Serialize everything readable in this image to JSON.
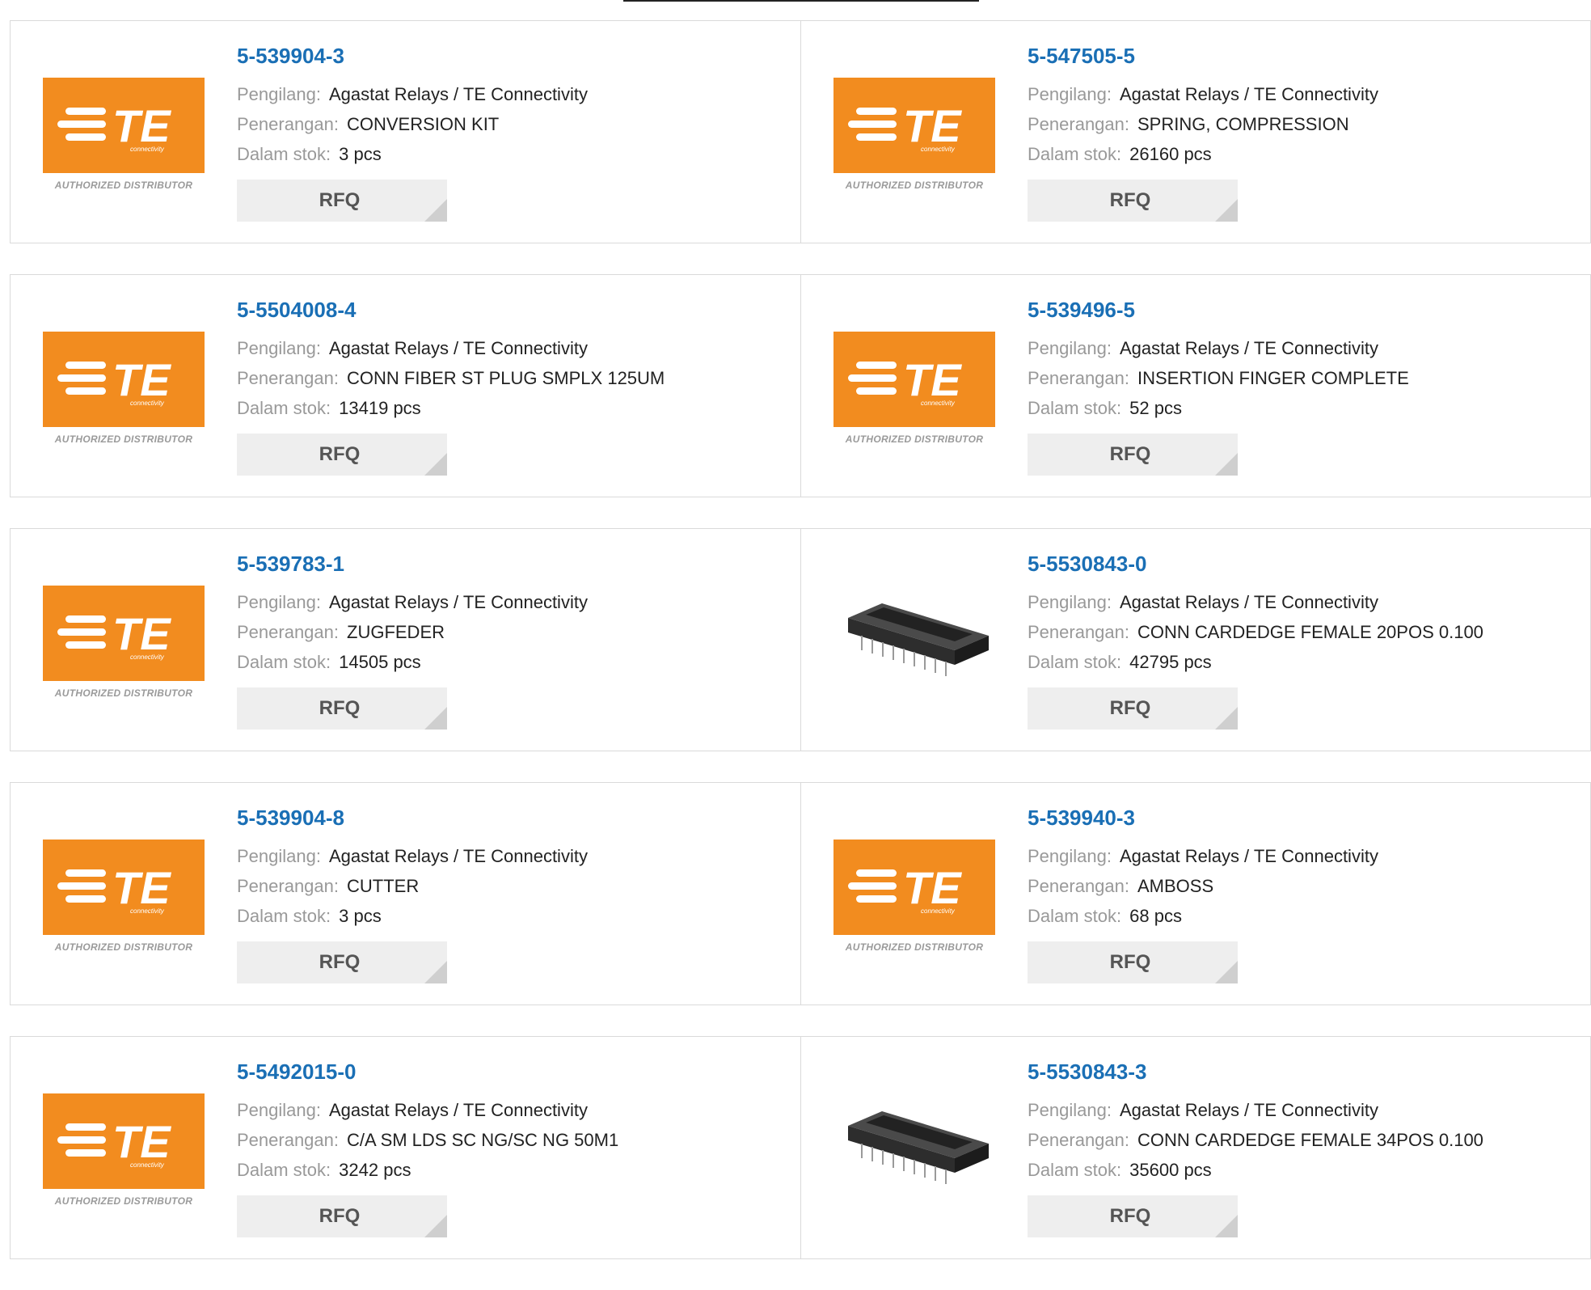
{
  "labels": {
    "manufacturer": "Pengilang:",
    "description": "Penerangan:",
    "stock": "Dalam stok:",
    "rfq": "RFQ",
    "logo_text": "TE",
    "logo_sub": "connectivity",
    "authorized": "AUTHORIZED DISTRIBUTOR"
  },
  "colors": {
    "accent": "#f28c1f",
    "link": "#1a6fb5"
  },
  "products": [
    {
      "part": "5-539904-3",
      "manufacturer": "Agastat Relays / TE Connectivity",
      "description": "CONVERSION KIT",
      "stock": "3 pcs",
      "image": "te-logo"
    },
    {
      "part": "5-547505-5",
      "manufacturer": "Agastat Relays / TE Connectivity",
      "description": "SPRING, COMPRESSION",
      "stock": "26160 pcs",
      "image": "te-logo"
    },
    {
      "part": "5-5504008-4",
      "manufacturer": "Agastat Relays / TE Connectivity",
      "description": "CONN FIBER ST PLUG SMPLX 125UM",
      "stock": "13419 pcs",
      "image": "te-logo"
    },
    {
      "part": "5-539496-5",
      "manufacturer": "Agastat Relays / TE Connectivity",
      "description": "INSERTION FINGER COMPLETE",
      "stock": "52 pcs",
      "image": "te-logo"
    },
    {
      "part": "5-539783-1",
      "manufacturer": "Agastat Relays / TE Connectivity",
      "description": "ZUGFEDER",
      "stock": "14505 pcs",
      "image": "te-logo"
    },
    {
      "part": "5-5530843-0",
      "manufacturer": "Agastat Relays / TE Connectivity",
      "description": "CONN CARDEDGE FEMALE 20POS 0.100",
      "stock": "42795 pcs",
      "image": "connector"
    },
    {
      "part": "5-539904-8",
      "manufacturer": "Agastat Relays / TE Connectivity",
      "description": "CUTTER",
      "stock": "3 pcs",
      "image": "te-logo"
    },
    {
      "part": "5-539940-3",
      "manufacturer": "Agastat Relays / TE Connectivity",
      "description": "AMBOSS",
      "stock": "68 pcs",
      "image": "te-logo"
    },
    {
      "part": "5-5492015-0",
      "manufacturer": "Agastat Relays / TE Connectivity",
      "description": "C/A SM LDS SC NG/SC NG 50M1",
      "stock": "3242 pcs",
      "image": "te-logo"
    },
    {
      "part": "5-5530843-3",
      "manufacturer": "Agastat Relays / TE Connectivity",
      "description": "CONN CARDEDGE FEMALE 34POS 0.100",
      "stock": "35600 pcs",
      "image": "connector"
    }
  ]
}
